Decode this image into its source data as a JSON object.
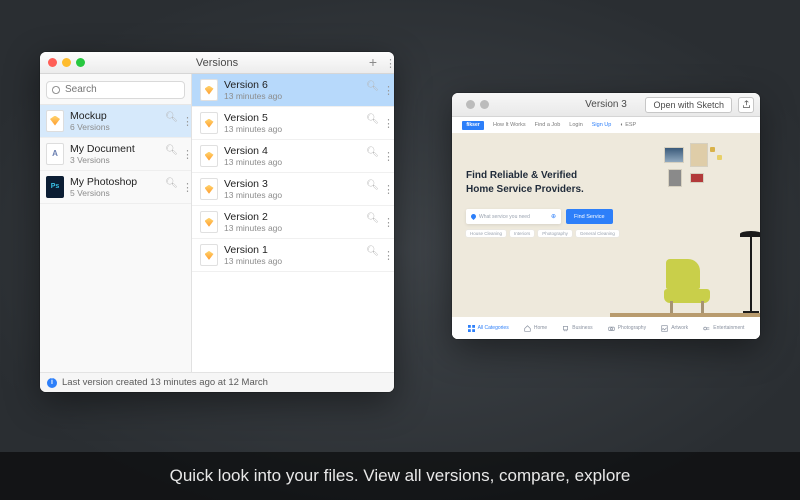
{
  "caption": "Quick look into your files. View all versions, compare, explore",
  "versions_window": {
    "title": "Versions",
    "search_placeholder": "Search",
    "files": [
      {
        "name": "Mockup",
        "sub": "6 Versions",
        "icon": "sketch",
        "selected": true
      },
      {
        "name": "My Document",
        "sub": "3 Versions",
        "icon": "doc",
        "selected": false
      },
      {
        "name": "My Photoshop",
        "sub": "5 Versions",
        "icon": "ps",
        "selected": false
      }
    ],
    "versions": [
      {
        "name": "Version 6",
        "sub": "13 minutes ago",
        "selected": true
      },
      {
        "name": "Version 5",
        "sub": "13 minutes ago",
        "selected": false
      },
      {
        "name": "Version 4",
        "sub": "13 minutes ago",
        "selected": false
      },
      {
        "name": "Version 3",
        "sub": "13 minutes ago",
        "selected": false
      },
      {
        "name": "Version 2",
        "sub": "13 minutes ago",
        "selected": false
      },
      {
        "name": "Version 1",
        "sub": "13 minutes ago",
        "selected": false
      }
    ],
    "status": "Last version created 13 minutes ago at 12 March"
  },
  "preview_window": {
    "title": "Version 3",
    "open_button": "Open with Sketch",
    "mock": {
      "logo": "fikser",
      "nav": [
        "How It Works",
        "Find a Job",
        "Login"
      ],
      "signup": "Sign Up",
      "lang": "ESP",
      "headline1": "Find Reliable & Verified",
      "headline2": "Home Service Providers.",
      "search_placeholder": "What service you need",
      "search_button": "Find Service",
      "tags": [
        "House Cleaning",
        "Interiors",
        "Photography",
        "General Cleaning"
      ],
      "categories": [
        {
          "label": "All Categories",
          "active": true
        },
        {
          "label": "Home"
        },
        {
          "label": "Business"
        },
        {
          "label": "Photography"
        },
        {
          "label": "Artwork"
        },
        {
          "label": "Entertainment"
        }
      ]
    }
  }
}
